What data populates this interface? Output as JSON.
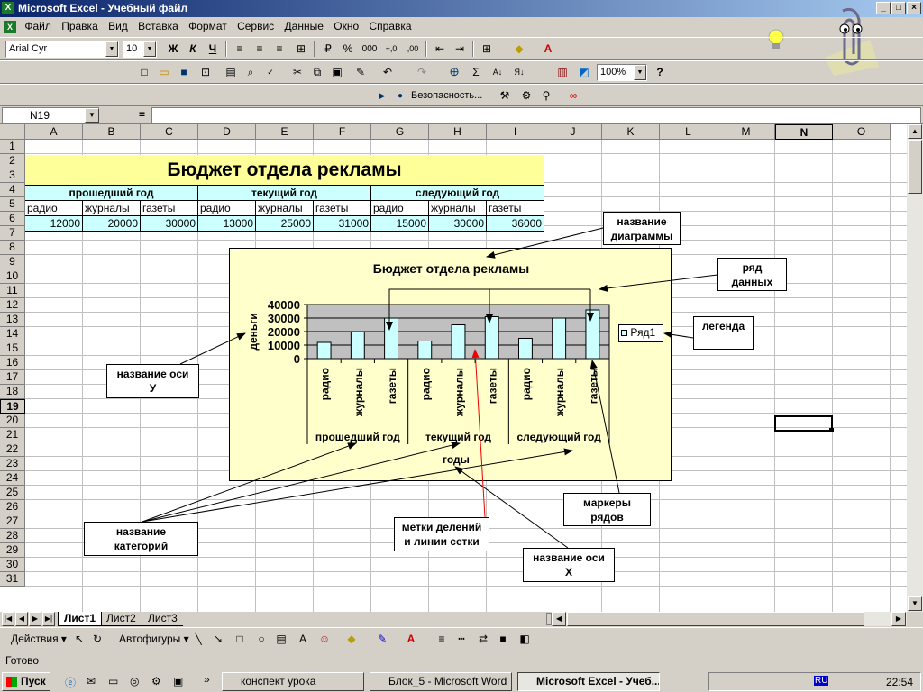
{
  "window": {
    "title": "Microsoft Excel - Учебный файл",
    "min": "_",
    "max": "□",
    "close": "×"
  },
  "menu": [
    "Файл",
    "Правка",
    "Вид",
    "Вставка",
    "Формат",
    "Сервис",
    "Данные",
    "Окно",
    "Справка"
  ],
  "format_bar": {
    "font": "Arial Cyr",
    "size": "10",
    "bold": "Ж",
    "italic": "К",
    "underline": "Ч",
    "percent": "%",
    "thousands": "000"
  },
  "standard_bar": {
    "zoom": "100%",
    "sum": "Σ"
  },
  "macro_bar": {
    "security": "Безопасность..."
  },
  "namebox": "N19",
  "formula_eq": "=",
  "columns": [
    "A",
    "B",
    "C",
    "D",
    "E",
    "F",
    "G",
    "H",
    "I",
    "J",
    "K",
    "L",
    "M",
    "N",
    "O"
  ],
  "rows": [
    "1",
    "2",
    "3",
    "4",
    "5",
    "6",
    "7",
    "8",
    "9",
    "10",
    "11",
    "12",
    "13",
    "14",
    "15",
    "16",
    "17",
    "18",
    "19",
    "20",
    "21",
    "22",
    "23",
    "24",
    "25",
    "26",
    "27",
    "28",
    "29",
    "30",
    "31"
  ],
  "sheet": {
    "title": "Бюджет отдела рекламы",
    "years": [
      "прошедший год",
      "текущий год",
      "следующий год"
    ],
    "media": [
      "радио",
      "журналы",
      "газеты",
      "радио",
      "журналы",
      "газеты",
      "радио",
      "журналы",
      "газеты"
    ],
    "values": [
      "12000",
      "20000",
      "30000",
      "13000",
      "25000",
      "31000",
      "15000",
      "30000",
      "36000"
    ]
  },
  "chart_data": {
    "type": "bar",
    "title": "Бюджет отдела рекламы",
    "ylabel": "деньги",
    "xlabel": "годы",
    "ylim": [
      0,
      40000
    ],
    "yticks": [
      "40000",
      "30000",
      "20000",
      "10000",
      "0"
    ],
    "groups": [
      "прошедший год",
      "текущий год",
      "следующий год"
    ],
    "categories": [
      "радио",
      "журналы",
      "газеты",
      "радио",
      "журналы",
      "газеты",
      "радио",
      "журналы",
      "газеты"
    ],
    "series": [
      {
        "name": "Ряд1",
        "values": [
          12000,
          20000,
          30000,
          13000,
          25000,
          31000,
          15000,
          30000,
          36000
        ],
        "color": "#ccffff"
      }
    ],
    "legend": "right",
    "grid": true,
    "plot_color": "#c0c0c0"
  },
  "callouts": {
    "chart_name": [
      "название",
      "диаграммы"
    ],
    "series": [
      "ряд",
      "данных"
    ],
    "legend": [
      "легенда"
    ],
    "y_axis": [
      "название оси",
      "У"
    ],
    "categories": [
      "название",
      "категорий"
    ],
    "ticks": [
      "метки делений",
      "и линии сетки"
    ],
    "markers": [
      "маркеры",
      "рядов"
    ],
    "x_axis": [
      "название оси",
      "Х"
    ]
  },
  "tabs": [
    "Лист1",
    "Лист2",
    "Лист3"
  ],
  "drawing": {
    "actions": "Действия",
    "autoshapes": "Автофигуры"
  },
  "status": "Готово",
  "taskbar": {
    "start": "Пуск",
    "items": [
      "конспект урока",
      "Блок_5 - Microsoft Word",
      "Microsoft Excel - Учеб..."
    ],
    "lang": "RU",
    "clock": "22:54"
  },
  "colors": {
    "title_bg": "#ffff99",
    "header_bg": "#ccffff",
    "chart_bg": "#ffffcc",
    "bar": "#ccffff",
    "titlebar": "#0a246a"
  }
}
